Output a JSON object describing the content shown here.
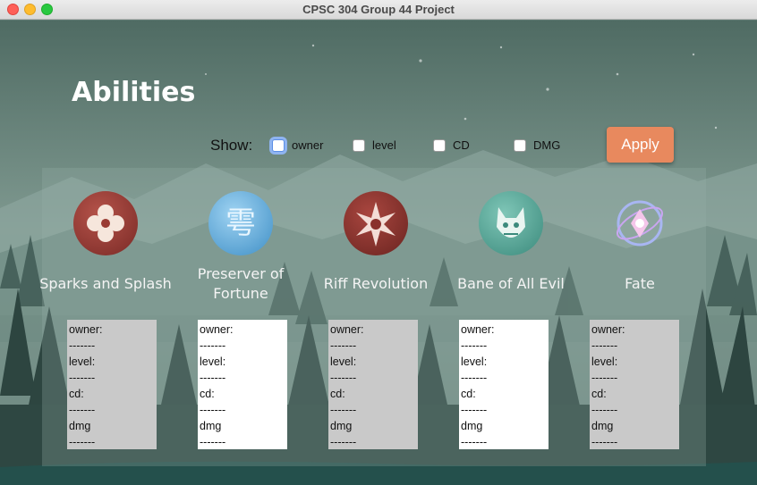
{
  "window": {
    "title": "CPSC 304 Group 44 Project"
  },
  "page": {
    "title": "Abilities"
  },
  "filters": {
    "show_label": "Show:",
    "options": [
      {
        "label": "owner",
        "checked": false
      },
      {
        "label": "level",
        "checked": false
      },
      {
        "label": "CD",
        "checked": false
      },
      {
        "label": "DMG",
        "checked": false
      }
    ],
    "apply_label": "Apply"
  },
  "abilities": [
    {
      "name": "Sparks and Splash",
      "icon": "flower-emblem-icon"
    },
    {
      "name": "Preserver of Fortune",
      "icon": "blue-rune-icon"
    },
    {
      "name": "Riff Revolution",
      "icon": "star-burst-icon"
    },
    {
      "name": "Bane of All Evil",
      "icon": "demon-mask-icon"
    },
    {
      "name": "Fate",
      "icon": "crystal-orb-icon"
    }
  ],
  "details": {
    "owner": "owner:",
    "level": "level:",
    "cd": "cd:",
    "dmg": "dmg",
    "separator": "-------"
  },
  "colors": {
    "accent": "#e8895e",
    "background": "#5f7a72"
  }
}
